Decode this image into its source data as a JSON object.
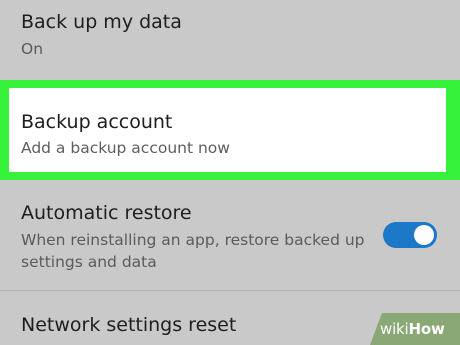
{
  "settings": {
    "backup_data": {
      "title": "Back up my data",
      "subtitle": "On"
    },
    "backup_account": {
      "title": "Backup account",
      "subtitle": "Add a backup account now"
    },
    "automatic_restore": {
      "title": "Automatic restore",
      "subtitle": "When reinstalling an app, restore backed up settings and data",
      "toggle_state": "on"
    },
    "network_reset": {
      "title": "Network settings reset"
    }
  },
  "watermark": {
    "prefix": "wiki",
    "suffix": "How"
  },
  "colors": {
    "highlight": "#37f23a",
    "toggle_on": "#1e78c8",
    "background": "#c9c9c9"
  }
}
